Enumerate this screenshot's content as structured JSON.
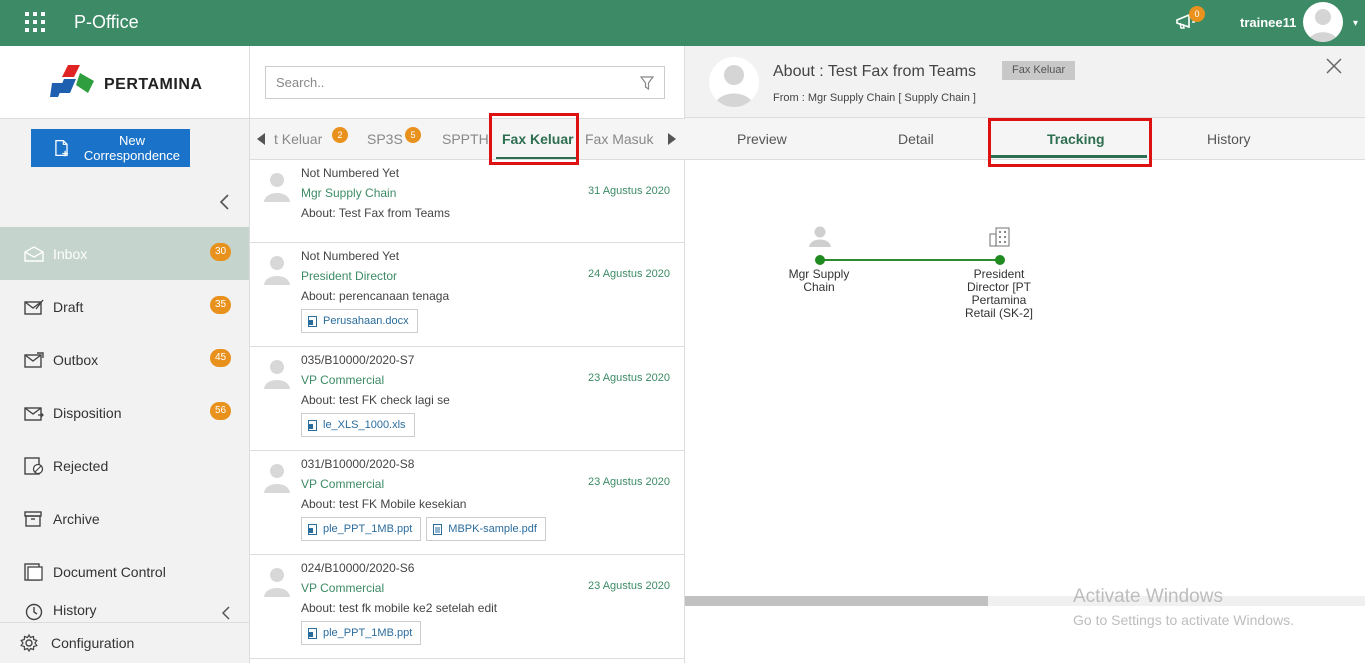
{
  "app": {
    "title": "P-Office",
    "notification_count": "0",
    "username": "trainee11"
  },
  "sidebar": {
    "logo_text": "PERTAMINA",
    "new_button": "New Correspondence",
    "items": [
      {
        "label": "Inbox",
        "badge": "30",
        "icon": "inbox-icon"
      },
      {
        "label": "Draft",
        "badge": "35",
        "icon": "draft-icon"
      },
      {
        "label": "Outbox",
        "badge": "45",
        "icon": "outbox-icon"
      },
      {
        "label": "Disposition",
        "badge": "56",
        "icon": "disposition-icon"
      },
      {
        "label": "Rejected",
        "badge": "",
        "icon": "rejected-icon"
      },
      {
        "label": "Archive",
        "badge": "",
        "icon": "archive-icon"
      },
      {
        "label": "Document Control",
        "badge": "",
        "icon": "document-control-icon"
      },
      {
        "label": "History",
        "badge": "",
        "icon": "history-icon"
      }
    ],
    "config_label": "Configuration"
  },
  "search": {
    "placeholder": "Search.."
  },
  "tabs": [
    {
      "label": "t Keluar",
      "badge": "2"
    },
    {
      "label": "SP3S",
      "badge": "5"
    },
    {
      "label": "SPPTH",
      "badge": ""
    },
    {
      "label": "Fax Keluar",
      "badge": ""
    },
    {
      "label": "Fax Masuk",
      "badge": ""
    }
  ],
  "active_tab": "Fax Keluar",
  "list": [
    {
      "number": "Not Numbered Yet",
      "sender": "Mgr Supply Chain",
      "date": "31 Agustus 2020",
      "about": "About: Test Fax from Teams",
      "attachments": []
    },
    {
      "number": "Not Numbered Yet",
      "sender": "President Director",
      "date": "24 Agustus 2020",
      "about": "About: perencanaan tenaga",
      "attachments": [
        {
          "name": "Perusahaan.docx",
          "type": "doc"
        }
      ]
    },
    {
      "number": "035/B10000/2020-S7",
      "sender": "VP Commercial",
      "date": "23 Agustus 2020",
      "about": "About: test FK check lagi se",
      "attachments": [
        {
          "name": "le_XLS_1000.xls",
          "type": "xls"
        }
      ]
    },
    {
      "number": "031/B10000/2020-S8",
      "sender": "VP Commercial",
      "date": "23 Agustus 2020",
      "about": "About: test FK Mobile kesekian",
      "attachments": [
        {
          "name": "ple_PPT_1MB.ppt",
          "type": "ppt"
        },
        {
          "name": "MBPK-sample.pdf",
          "type": "pdf"
        }
      ]
    },
    {
      "number": "024/B10000/2020-S6",
      "sender": "VP Commercial",
      "date": "23 Agustus 2020",
      "about": "About: test fk mobile ke2 setelah edit",
      "attachments": [
        {
          "name": "ple_PPT_1MB.ppt",
          "type": "ppt"
        }
      ]
    }
  ],
  "detail": {
    "subject": "About : Test Fax from Teams",
    "tag": "Fax Keluar",
    "from": "From : Mgr Supply Chain [ Supply Chain ]",
    "tabs": [
      "Preview",
      "Detail",
      "Tracking",
      "History"
    ],
    "active_tab": "Tracking",
    "tracking_nodes": [
      {
        "label": "Mgr Supply Chain",
        "icon": "person-icon"
      },
      {
        "label": "President Director [PT Pertamina Retail (SK-2]",
        "icon": "building-icon"
      }
    ]
  },
  "watermark": {
    "line1": "Activate Windows",
    "line2": "Go to Settings to activate Windows."
  },
  "colors": {
    "header": "#3d8b66",
    "accent": "#2e6e50",
    "badge": "#e8911c",
    "button": "#1a73c8",
    "highlight": "#dd1111"
  }
}
